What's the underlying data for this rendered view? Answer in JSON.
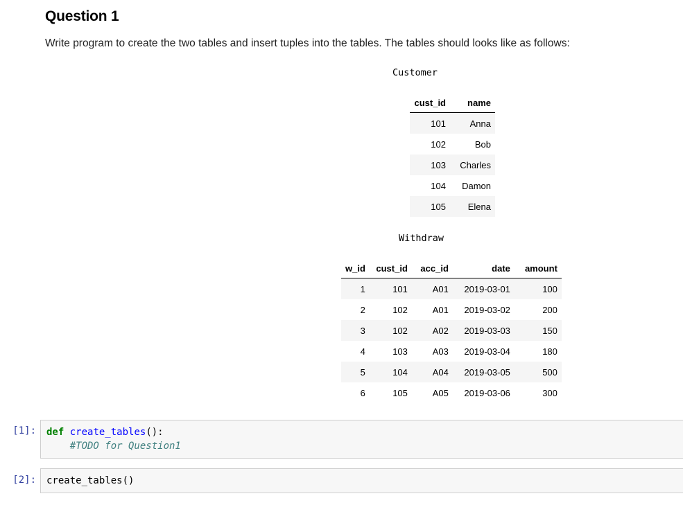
{
  "question": {
    "title": "Question 1",
    "text": "Write program to create the two tables and insert tuples into the tables. The tables should looks like as follows:"
  },
  "customer_table": {
    "caption": "Customer",
    "headers": [
      "cust_id",
      "name"
    ],
    "rows": [
      [
        "101",
        "Anna"
      ],
      [
        "102",
        "Bob"
      ],
      [
        "103",
        "Charles"
      ],
      [
        "104",
        "Damon"
      ],
      [
        "105",
        "Elena"
      ]
    ]
  },
  "withdraw_table": {
    "caption": "Withdraw",
    "headers": [
      "w_id",
      "cust_id",
      "acc_id",
      "date",
      "amount"
    ],
    "rows": [
      [
        "1",
        "101",
        "A01",
        "2019-03-01",
        "100"
      ],
      [
        "2",
        "102",
        "A01",
        "2019-03-02",
        "200"
      ],
      [
        "3",
        "102",
        "A02",
        "2019-03-03",
        "150"
      ],
      [
        "4",
        "103",
        "A03",
        "2019-03-04",
        "180"
      ],
      [
        "5",
        "104",
        "A04",
        "2019-03-05",
        "500"
      ],
      [
        "6",
        "105",
        "A05",
        "2019-03-06",
        "300"
      ]
    ]
  },
  "cells": [
    {
      "prompt": "[1]:",
      "keyword": "def",
      "func_name": "create_tables",
      "signature_rest": "():",
      "comment": "#TODO for Question1"
    },
    {
      "prompt": "[2]:",
      "code": "create_tables()"
    }
  ]
}
